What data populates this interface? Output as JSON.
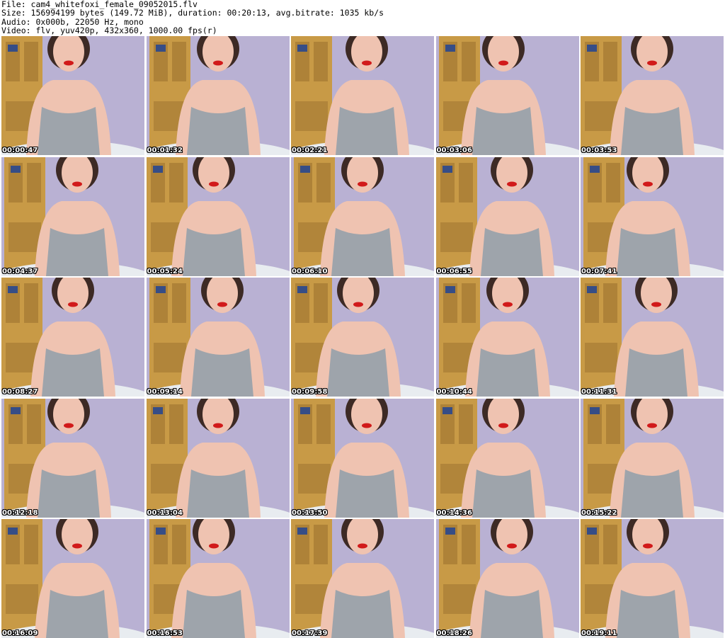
{
  "header": {
    "file": "File: cam4_whitefoxi_female_09052015.flv",
    "size": "Size: 156994199 bytes (149.72 MiB), duration: 00:20:13, avg.bitrate: 1035 kb/s",
    "audio": "Audio: 0x000b, 22050 Hz, mono",
    "video": "Video: flv, yuv420p, 432x360, 1000.00 fps(r)"
  },
  "thumbnails": [
    {
      "time": "00:00:47",
      "layout": "left"
    },
    {
      "time": "00:01:32",
      "layout": "right"
    },
    {
      "time": "00:02:21",
      "layout": "left"
    },
    {
      "time": "00:03:06",
      "layout": "right"
    },
    {
      "time": "00:03:53",
      "layout": "left"
    },
    {
      "time": "00:04:37",
      "layout": "right"
    },
    {
      "time": "00:05:24",
      "layout": "left"
    },
    {
      "time": "00:06:10",
      "layout": "right"
    },
    {
      "time": "00:06:55",
      "layout": "left"
    },
    {
      "time": "00:07:41",
      "layout": "right"
    },
    {
      "time": "00:08:27",
      "layout": "left"
    },
    {
      "time": "00:09:14",
      "layout": "right"
    },
    {
      "time": "00:09:58",
      "layout": "left"
    },
    {
      "time": "00:10:44",
      "layout": "right"
    },
    {
      "time": "00:11:31",
      "layout": "left"
    },
    {
      "time": "00:12:18",
      "layout": "right"
    },
    {
      "time": "00:13:04",
      "layout": "left"
    },
    {
      "time": "00:13:50",
      "layout": "right"
    },
    {
      "time": "00:14:36",
      "layout": "left"
    },
    {
      "time": "00:15:22",
      "layout": "right"
    },
    {
      "time": "00:16:09",
      "layout": "left"
    },
    {
      "time": "00:16:53",
      "layout": "right"
    },
    {
      "time": "00:17:39",
      "layout": "left"
    },
    {
      "time": "00:18:26",
      "layout": "right"
    },
    {
      "time": "00:19:11",
      "layout": "left"
    }
  ],
  "colors": {
    "wall": "#b9b1d3",
    "wood": "#c89a46",
    "wood_dark": "#8f6627",
    "monitor_blue": "#364d86",
    "fabric": "#9ea4ab",
    "skin": "#efc3b1",
    "hair": "#3d2a25",
    "accent_red": "#d11a1a"
  }
}
